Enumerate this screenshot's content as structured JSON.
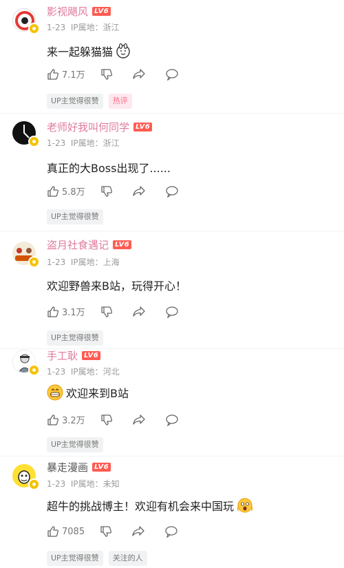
{
  "comments": [
    {
      "username": "影视飓风",
      "level": "LV6",
      "date": "1-23",
      "ip": "IP属地：浙江",
      "text": "来一起躲猫猫",
      "emoji_icon": "rabbit-face-emoji",
      "likes": "7.1万",
      "tags": [
        "UP主觉得很赞",
        "热评"
      ],
      "username_color": "#e07a9d"
    },
    {
      "username": "老师好我叫何同学",
      "level": "LV6",
      "date": "1-23",
      "ip": "IP属地：浙江",
      "text": "真正的大Boss出现了......",
      "likes": "5.8万",
      "tags": [
        "UP主觉得很赞"
      ],
      "username_color": "#e07a9d"
    },
    {
      "username": "盗月社食遇记",
      "level": "LV6",
      "date": "1-23",
      "ip": "IP属地：上海",
      "text": "欢迎野兽来B站，玩得开心！",
      "likes": "3.1万",
      "tags": [
        "UP主觉得很赞"
      ],
      "username_color": "#e07a9d"
    },
    {
      "username": "手工耿",
      "level": "LV6",
      "date": "1-23",
      "ip": "IP属地：河北",
      "text": "欢迎来到B站",
      "emoji_icon": "grinning-face-emoji",
      "likes": "3.2万",
      "tags": [
        "UP主觉得很赞"
      ],
      "username_color": "#e07a9d"
    },
    {
      "username": "暴走漫画",
      "level": "LV6",
      "date": "1-23",
      "ip": "IP属地：未知",
      "text": "超牛的挑战博主！欢迎有机会来中国玩",
      "emoji_icon": "screaming-face-emoji",
      "likes": "7085",
      "tags": [
        "UP主觉得很赞",
        "关注的人"
      ],
      "username_color": "#555555"
    }
  ],
  "colors": {
    "vip_name": "#e07a9d",
    "level_badge": "#ff5b52",
    "verified_badge": "#f6c100",
    "hot_tag_text": "#ff6b8a"
  }
}
